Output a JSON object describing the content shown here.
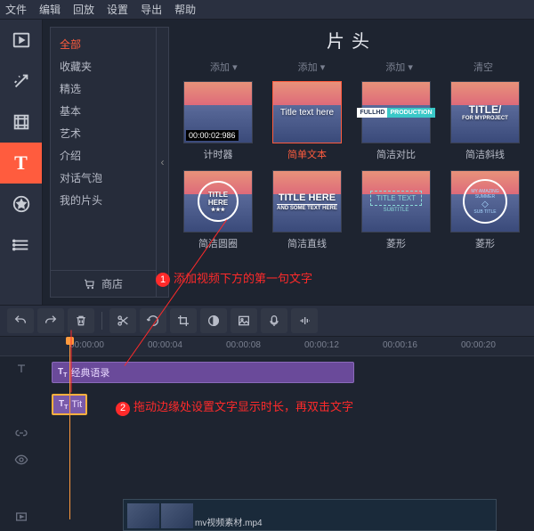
{
  "menu": {
    "file": "文件",
    "edit": "编辑",
    "playback": "回放",
    "settings": "设置",
    "export": "导出",
    "help": "帮助"
  },
  "sidebar": {
    "items": [
      {
        "name": "media",
        "icon": "film"
      },
      {
        "name": "fx",
        "icon": "wand"
      },
      {
        "name": "filters",
        "icon": "filmstrip"
      },
      {
        "name": "titles",
        "icon": "T"
      },
      {
        "name": "stickers",
        "icon": "star"
      },
      {
        "name": "more",
        "icon": "list"
      }
    ]
  },
  "categories": {
    "items": [
      "全部",
      "收藏夹",
      "精选",
      "基本",
      "艺术",
      "介绍",
      "对话气泡",
      "我的片头"
    ],
    "active": 0,
    "store": "商店"
  },
  "panel": {
    "title": "片头",
    "sort": [
      "添加",
      "添加",
      "添加",
      "清空"
    ]
  },
  "cards": [
    {
      "label": "计时器",
      "timecode": "00:00:02:986",
      "type": "timer"
    },
    {
      "label": "简单文本",
      "type": "simpletext",
      "text": "Title text here",
      "selected": true
    },
    {
      "label": "简洁对比",
      "type": "contrast",
      "left": "FULLHD",
      "right": "PRODUCTION"
    },
    {
      "label": "简洁斜线",
      "type": "slash",
      "main": "TITLE/",
      "sub": "FOR MYPROJECT"
    },
    {
      "label": "简洁圆圈",
      "type": "circle",
      "main": "TITLE HERE",
      "sub": "★★★"
    },
    {
      "label": "简洁直线",
      "type": "line",
      "main": "TITLE HERE",
      "sub": "AND SOME TEXT HERE"
    },
    {
      "label": "菱形",
      "type": "diamond",
      "main": "TITLE TEXT",
      "sub": "SUBTITLE"
    },
    {
      "label": "菱形",
      "type": "diamond2",
      "main": "MY AMAZING SUMMER",
      "sub": "SUB TITLE"
    }
  ],
  "ruler": {
    "ticks": [
      "00:00:00",
      "00:00:04",
      "00:00:08",
      "00:00:12",
      "00:00:16",
      "00:00:20"
    ]
  },
  "clips": {
    "title1": "经典语录",
    "title2": "Tit",
    "video": "mv视频素材.mp4"
  },
  "annotations": {
    "a1": "添加视频下方的第一句文字",
    "a2": "拖动边缘处设置文字显示时长，再双击文字"
  }
}
